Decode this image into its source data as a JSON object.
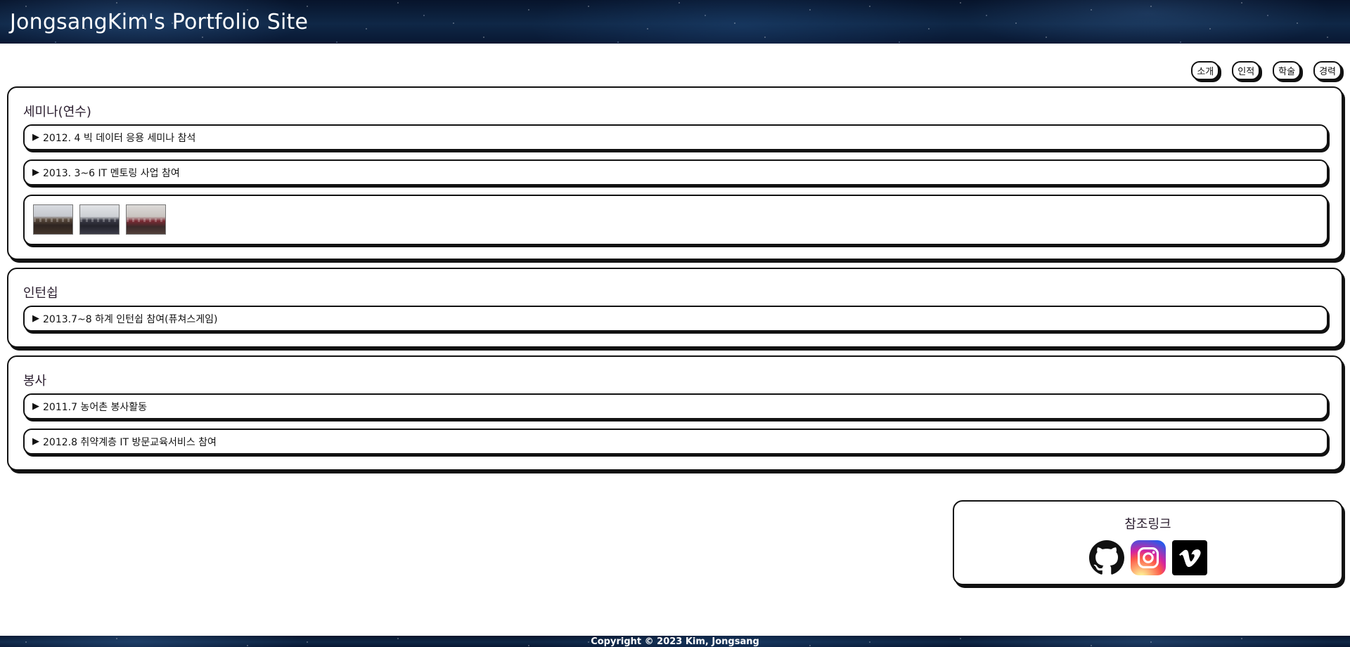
{
  "header": {
    "title": "JongsangKim's Portfolio Site"
  },
  "nav": {
    "items": [
      {
        "label": "소개"
      },
      {
        "label": "인적"
      },
      {
        "label": "학술"
      },
      {
        "label": "경력"
      }
    ]
  },
  "sections": {
    "seminar": {
      "title": "세미나(연수)",
      "items": [
        {
          "label": "2012. 4 빅 데이터 응용 세미나 참석"
        },
        {
          "label": "2013. 3~6 IT 멘토링 사업 참여"
        }
      ],
      "gallery_count": 3
    },
    "internship": {
      "title": "인턴쉽",
      "items": [
        {
          "label": "2013.7~8 하계 인턴쉽 참여(퓨쳐스게임)"
        }
      ]
    },
    "volunteer": {
      "title": "봉사",
      "items": [
        {
          "label": "2011.7 농어촌 봉사활동"
        },
        {
          "label": "2012.8 취약계층 IT 방문교육서비스 참여"
        }
      ]
    }
  },
  "links": {
    "title": "참조링크",
    "icons": [
      "github-icon",
      "instagram-icon",
      "vimeo-icon"
    ]
  },
  "footer": {
    "copyright": "Copyright © 2023 Kim, Jongsang"
  },
  "colors": {
    "border": "#111111",
    "header_bg": "#0b1a33",
    "text": "#111111"
  }
}
